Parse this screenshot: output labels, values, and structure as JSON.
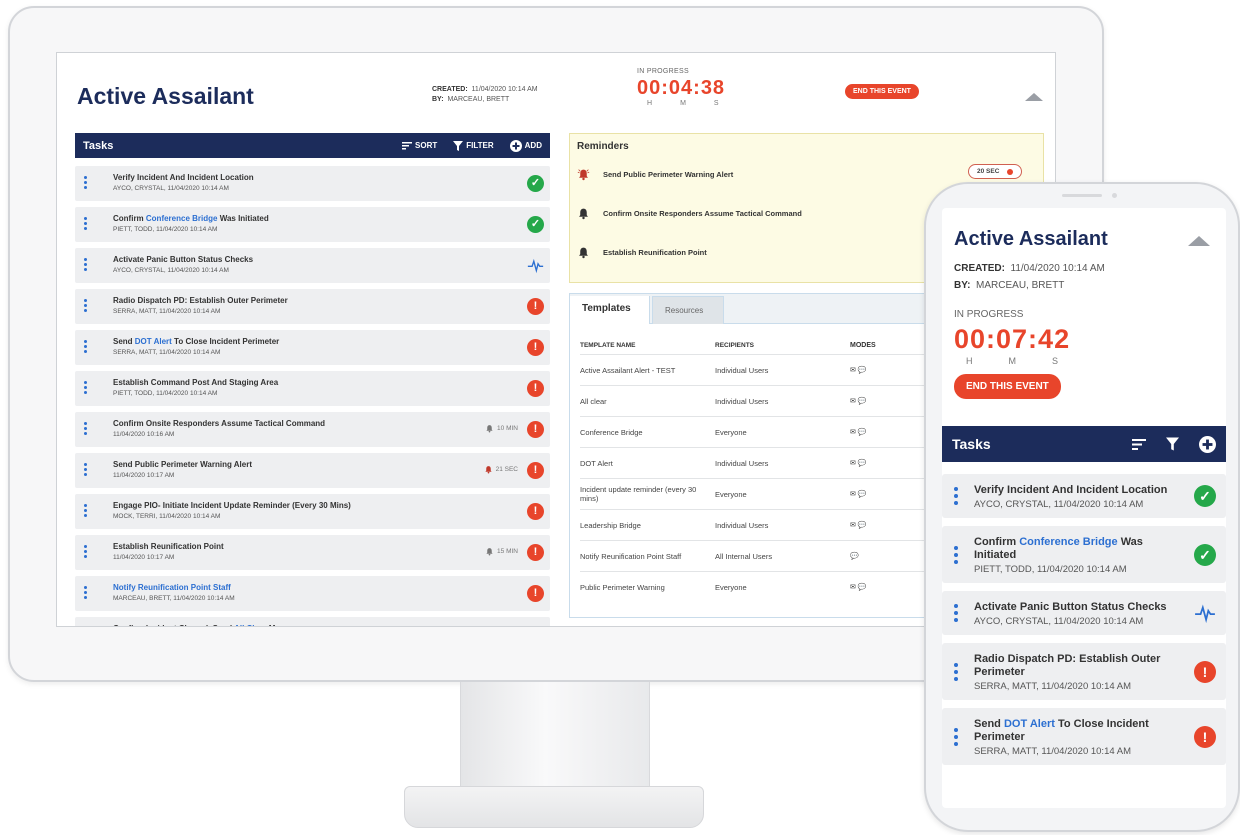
{
  "desktop": {
    "title": "Active Assailant",
    "created_label": "CREATED:",
    "created_value": "11/04/2020 10:14 AM",
    "by_label": "BY:",
    "by_value": "MARCEAU, BRETT",
    "status": "IN PROGRESS",
    "timer": "00:04:38",
    "timer_units": [
      "H",
      "M",
      "S"
    ],
    "end_button": "END THIS EVENT",
    "tasks_bar": {
      "title": "Tasks",
      "sort": "SORT",
      "filter": "FILTER",
      "add": "ADD"
    },
    "tasks": [
      {
        "title": "Verify Incident And Incident Location",
        "sub": "AYCO, CRYSTAL, 11/04/2020 10:14 AM",
        "status": "done"
      },
      {
        "title_pre": "Confirm ",
        "title_link": "Conference Bridge",
        "title_post": " Was Initiated",
        "sub": "PIETT, TODD, 11/04/2020 10:14 AM",
        "status": "done"
      },
      {
        "title": "Activate Panic Button Status Checks",
        "sub": "AYCO, CRYSTAL, 11/04/2020 10:14 AM",
        "status": "active"
      },
      {
        "title": "Radio Dispatch PD: Establish Outer Perimeter",
        "sub": "SERRA, MATT, 11/04/2020 10:14 AM",
        "status": "alert"
      },
      {
        "title_pre": "Send ",
        "title_link": "DOT Alert",
        "title_post": " To Close Incident Perimeter",
        "sub": "SERRA, MATT, 11/04/2020 10:14 AM",
        "status": "alert"
      },
      {
        "title": "Establish Command Post And Staging Area",
        "sub": "PIETT, TODD, 11/04/2020 10:14 AM",
        "status": "alert"
      },
      {
        "title": "Confirm Onsite Responders Assume Tactical Command",
        "sub": "11/04/2020 10:16 AM",
        "status": "alert",
        "timer": "10 MIN"
      },
      {
        "title": "Send Public Perimeter Warning Alert",
        "sub": "11/04/2020 10:17 AM",
        "status": "alert",
        "timer": "21 SEC"
      },
      {
        "title": "Engage PIO- Initiate Incident Update Reminder (Every 30 Mins)",
        "sub": "MOCK, TERRI, 11/04/2020 10:14 AM",
        "status": "alert"
      },
      {
        "title": "Establish Reunification Point",
        "sub": "11/04/2020 10:17 AM",
        "status": "alert",
        "timer": "15 MIN"
      },
      {
        "title_link": "Notify Reunification Point Staff",
        "sub": "MARCEAU, BRETT, 11/04/2020 10:14 AM",
        "status": "alert"
      },
      {
        "title_pre": "Confirm Incident Cleared, Send ",
        "title_link": "All Clear",
        "title_post": " Msg",
        "sub": "",
        "status": "alert"
      }
    ],
    "reminders": {
      "title": "Reminders",
      "items": [
        {
          "text": "Send Public Perimeter Warning Alert",
          "pill": "20 SEC"
        },
        {
          "text": "Confirm Onsite Responders Assume Tactical Command"
        },
        {
          "text": "Establish Reunification Point"
        }
      ]
    },
    "templates": {
      "tabs": [
        "Templates",
        "Resources"
      ],
      "headers": [
        "TEMPLATE NAME",
        "RECIPIENTS",
        "MODES"
      ],
      "rows": [
        [
          "Active Assailant Alert - TEST",
          "Individual Users",
          "✉ 💬"
        ],
        [
          "All clear",
          "Individual Users",
          "✉ 💬"
        ],
        [
          "Conference Bridge",
          "Everyone",
          "✉ 💬"
        ],
        [
          "DOT Alert",
          "Individual Users",
          "✉ 💬"
        ],
        [
          "Incident update reminder (every 30 mins)",
          "Everyone",
          "✉ 💬"
        ],
        [
          "Leadership Bridge",
          "Individual Users",
          "✉ 💬"
        ],
        [
          "Notify Reunification Point Staff",
          "All Internal Users",
          "💬"
        ],
        [
          "Public Perimeter Warning",
          "Everyone",
          "✉ 💬"
        ]
      ]
    }
  },
  "mobile": {
    "title": "Active Assailant",
    "created_label": "CREATED:",
    "created_value": "11/04/2020 10:14 AM",
    "by_label": "BY:",
    "by_value": "MARCEAU, BRETT",
    "status": "IN PROGRESS",
    "timer": "00:07:42",
    "timer_units": [
      "H",
      "M",
      "S"
    ],
    "end_button": "END THIS EVENT",
    "tasks_title": "Tasks",
    "tasks": [
      {
        "title": "Verify Incident And Incident Location",
        "sub": "AYCO, CRYSTAL, 11/04/2020 10:14 AM",
        "status": "done"
      },
      {
        "title_pre": "Confirm ",
        "title_link": "Conference Bridge",
        "title_post": " Was Initiated",
        "sub": "PIETT, TODD, 11/04/2020 10:14 AM",
        "status": "done"
      },
      {
        "title": "Activate Panic Button Status Checks",
        "sub": "AYCO, CRYSTAL, 11/04/2020 10:14 AM",
        "status": "active"
      },
      {
        "title": "Radio Dispatch PD: Establish Outer Perimeter",
        "sub": "SERRA, MATT, 11/04/2020 10:14 AM",
        "status": "alert"
      },
      {
        "title_pre": "Send ",
        "title_link": "DOT Alert",
        "title_post": " To Close Incident Perimeter",
        "sub": "SERRA, MATT, 11/04/2020 10:14 AM",
        "status": "alert"
      }
    ]
  },
  "colors": {
    "navy": "#1c2c5b",
    "alert": "#e8452b",
    "ok": "#25a84a",
    "link": "#2c6fd1",
    "reminder_bg": "#fdfbe4"
  },
  "icons": {
    "sort": "sort-icon",
    "filter": "filter-icon",
    "add": "plus-circle-icon",
    "done": "check-circle-icon",
    "alert": "exclamation-circle-icon",
    "active": "pulse-icon",
    "bell": "bell-icon",
    "menu": "kebab-icon"
  }
}
